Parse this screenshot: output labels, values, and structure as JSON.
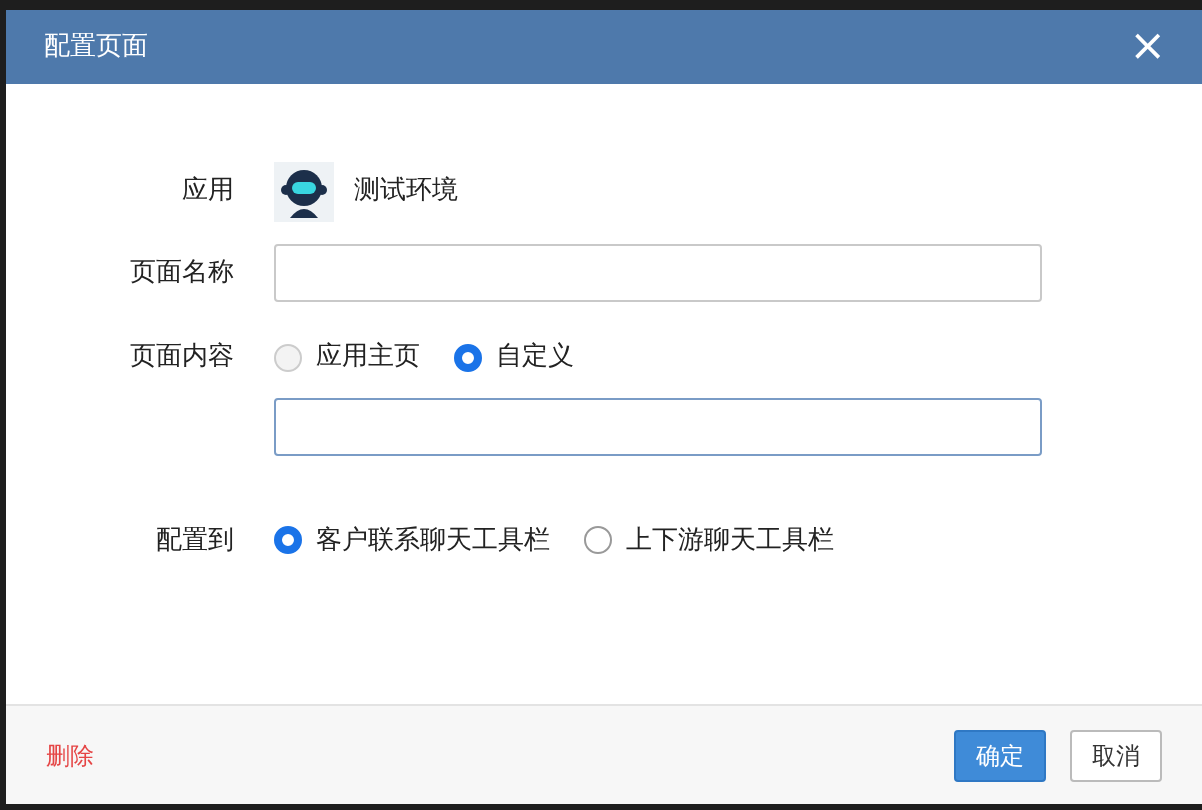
{
  "window": {
    "title": "配置页面",
    "close": "×"
  },
  "form": {
    "app": {
      "label": "应用",
      "name": "测试环境"
    },
    "page_name": {
      "label": "页面名称"
    },
    "page_content": {
      "label": "页面内容",
      "options": [
        {
          "label": "应用主页",
          "selected": false
        },
        {
          "label": "自定义",
          "selected": true
        }
      ]
    },
    "target": {
      "label": "配置到",
      "options": [
        {
          "label": "客户联系聊天工具栏",
          "selected": true
        },
        {
          "label": "上下游聊天工具栏",
          "selected": false
        }
      ]
    }
  },
  "footer": {
    "delete": "删除",
    "buttons": [
      {
        "label": "确定",
        "kind": "primary"
      },
      {
        "label": "取消",
        "kind": "secondary"
      }
    ]
  }
}
